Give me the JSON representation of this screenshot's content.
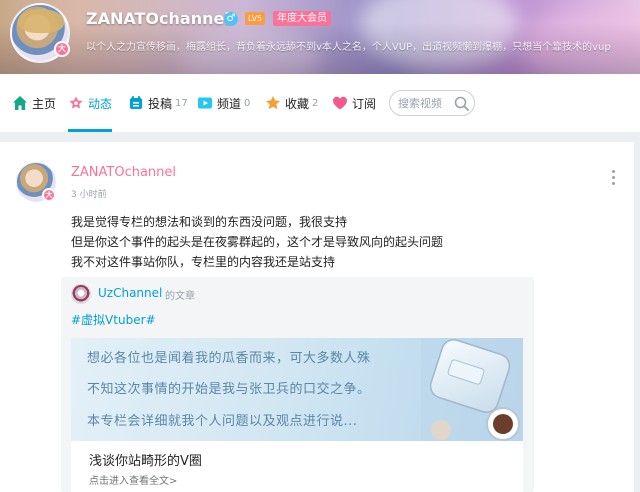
{
  "profile": {
    "username": "ZANATOchannel",
    "gender_symbol": "♂",
    "level": "LV5",
    "vip_label": "年度大会员",
    "signature": "以个人之力宣传移画，梅露组长，背负着永远舔不到v本人之名，个人VUP，出道视频懒到爆棚，只想当个靠技术的vup",
    "avatar_badge": "大"
  },
  "nav": {
    "items": [
      {
        "label": "主页",
        "count": "",
        "icon": "home-icon",
        "color": "#13a88a"
      },
      {
        "label": "动态",
        "count": "",
        "icon": "dynamic-icon",
        "color": "#fb7299"
      },
      {
        "label": "投稿",
        "count": "17",
        "icon": "upload-icon",
        "color": "#00a1d6"
      },
      {
        "label": "频道",
        "count": "0",
        "icon": "channel-icon",
        "color": "#23c9ed"
      },
      {
        "label": "收藏",
        "count": "2",
        "icon": "star-icon",
        "color": "#f3a034"
      },
      {
        "label": "订阅",
        "count": "",
        "icon": "heart-icon",
        "color": "#f45a8d"
      }
    ],
    "active_index": 1,
    "search_placeholder": "搜索视频"
  },
  "post": {
    "username": "ZANATOchannel",
    "time": "3 小时前",
    "lines": [
      "我是觉得专栏的想法和谈到的东西没问题，我很支持",
      "但是你这个事件的起头是在夜雾群起的，这个才是导致风向的起头问题",
      "我不对这件事站你队，专栏里的内容我还是站支持"
    ],
    "repost": {
      "username": "UzChannel",
      "type": "的文章",
      "tag": "#虚拟Vtuber#",
      "article": {
        "cover_lines": [
          "想必各位也是闻着我的瓜香而来，可大多数人殊",
          "不知这次事情的开始是我与张卫兵的口交之争。",
          "本专栏会详细就我个人问题以及观点进行说..."
        ],
        "title": "浅谈你站畸形的V圈",
        "link": "点击进入查看全文>"
      }
    }
  },
  "colors": {
    "accent": "#00a1d6",
    "pink": "#fb7299",
    "muted": "#99a2aa"
  }
}
